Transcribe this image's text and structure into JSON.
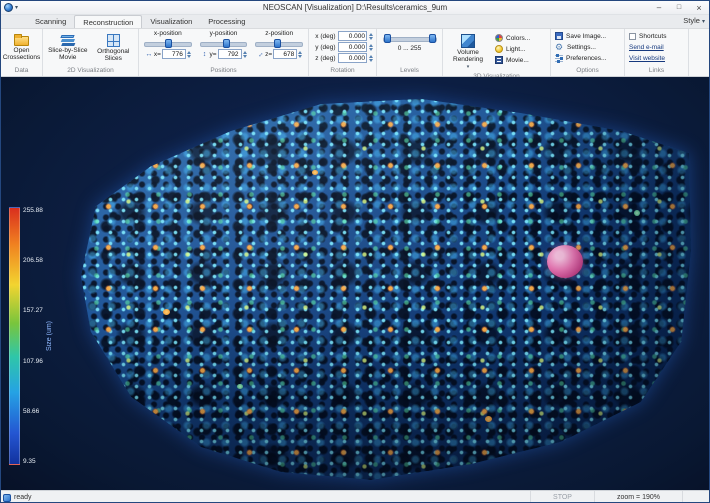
{
  "window": {
    "title": "NEOSCAN [Visualization] D:\\Results\\ceramics_9um",
    "style_label": "Style"
  },
  "tabs": {
    "scanning": "Scanning",
    "reconstruction": "Reconstruction",
    "visualization": "Visualization",
    "processing": "Processing"
  },
  "ribbon": {
    "data": {
      "caption": "Data",
      "open_crossections": "Open Crossections"
    },
    "vis2d": {
      "caption": "2D Visualization",
      "slice_movie": "Slice-by-Slice Movie",
      "orthogonal": "Orthogonal Slices"
    },
    "positions": {
      "caption": "Positions",
      "x": {
        "label": "x-position",
        "prefix": "x=",
        "value": "776"
      },
      "y": {
        "label": "y-position",
        "prefix": "y=",
        "value": "792"
      },
      "z": {
        "label": "z-position",
        "prefix": "z=",
        "value": "678"
      }
    },
    "rotation": {
      "caption": "Rotation",
      "x": {
        "label": "x (deg)",
        "value": "0.000"
      },
      "y": {
        "label": "y (deg)",
        "value": "0.000"
      },
      "z": {
        "label": "z (deg)",
        "value": "0.000"
      }
    },
    "levels": {
      "caption": "Levels",
      "range": "0 ... 255"
    },
    "vis3d": {
      "caption": "3D Visualization",
      "volume_rendering": "Volume Rendering",
      "colors": "Colors...",
      "light": "Light...",
      "movie": "Movie..."
    },
    "options": {
      "caption": "Options",
      "save_image": "Save Image...",
      "settings": "Settings...",
      "preferences": "Preferences..."
    },
    "links": {
      "caption": "Links",
      "shortcuts": "Shortcuts",
      "send_email": "Send e-mail",
      "visit_website": "Visit website"
    }
  },
  "colorbar": {
    "label": "Size (um)",
    "ticks": [
      "255.88",
      "206.58",
      "157.27",
      "107.96",
      "58.66",
      "9.35"
    ]
  },
  "statusbar": {
    "ready": "ready",
    "stop": "STOP",
    "zoom": "zoom = 190%"
  },
  "colors": {
    "accent": "#2a7fd4",
    "canvas_bg": "#0c1d3f"
  }
}
